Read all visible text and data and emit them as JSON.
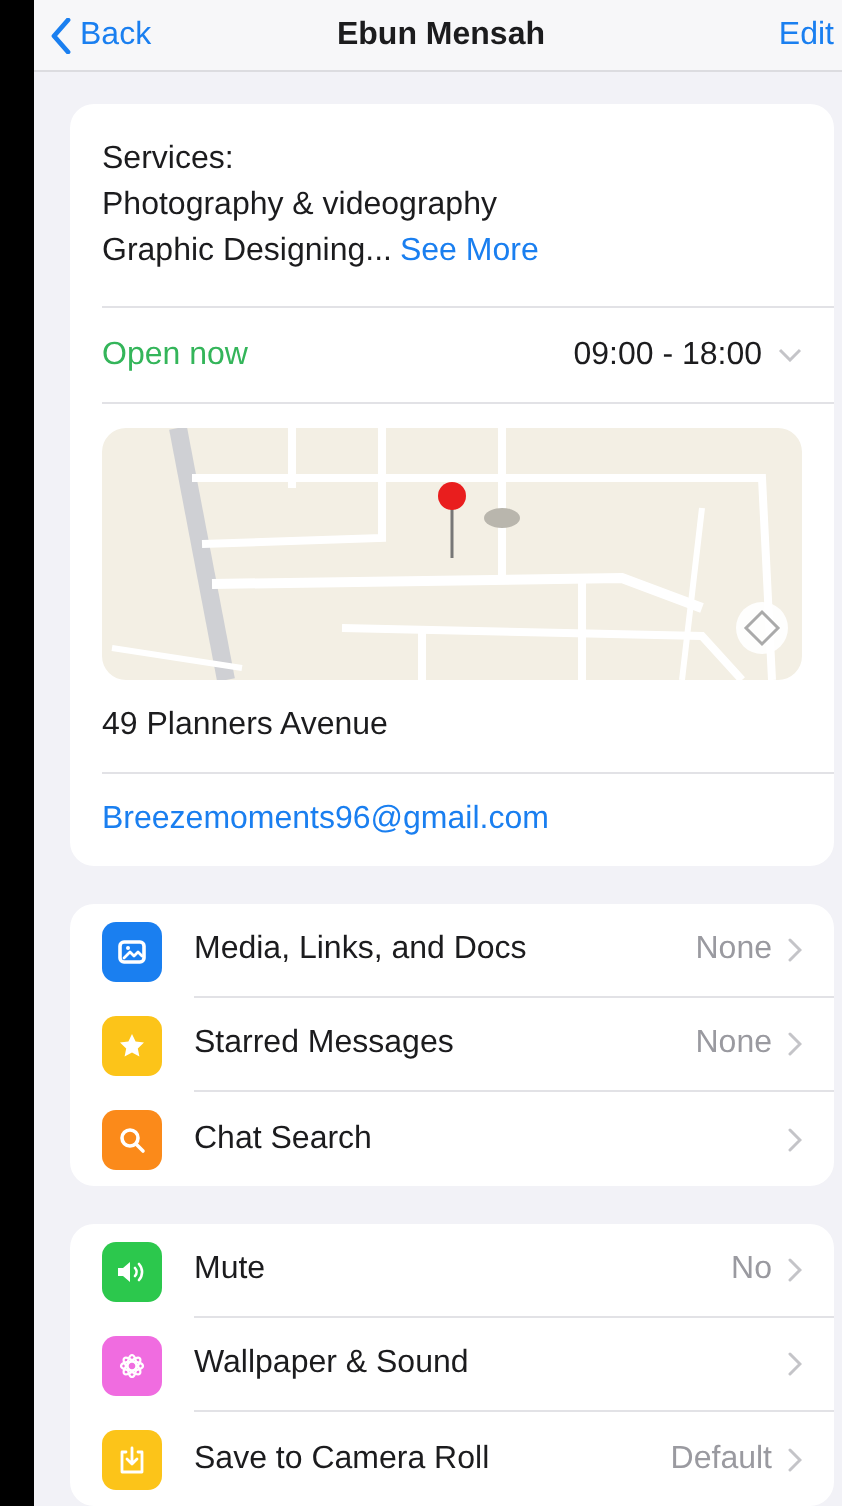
{
  "nav": {
    "back": "Back",
    "title": "Ebun Mensah",
    "edit": "Edit"
  },
  "info": {
    "services_label": "Services:",
    "services_lines": [
      "Photography & videography",
      "Graphic Designing..."
    ],
    "see_more": "See More",
    "open_status": "Open now",
    "hours": "09:00 - 18:00",
    "map": {
      "kind": "picture"
    },
    "address": "49 Planners Avenue",
    "email": "Breezemoments96@gmail.com"
  },
  "groups": [
    [
      {
        "kind": "media",
        "color": "#1a7ff0",
        "label": "Media, Links, and Docs",
        "value": "None"
      },
      {
        "kind": "star",
        "color": "#fcc419",
        "label": "Starred Messages",
        "value": "None"
      },
      {
        "kind": "search",
        "color": "#fb8a1a",
        "label": "Chat Search"
      }
    ],
    [
      {
        "kind": "speaker",
        "color": "#2cc84d",
        "label": "Mute",
        "value": "No"
      },
      {
        "kind": "flower",
        "color": "#f06ce0",
        "label": "Wallpaper & Sound"
      },
      {
        "kind": "download",
        "color": "#fcc419",
        "label": "Save to Camera Roll",
        "value": "Default"
      }
    ]
  ]
}
